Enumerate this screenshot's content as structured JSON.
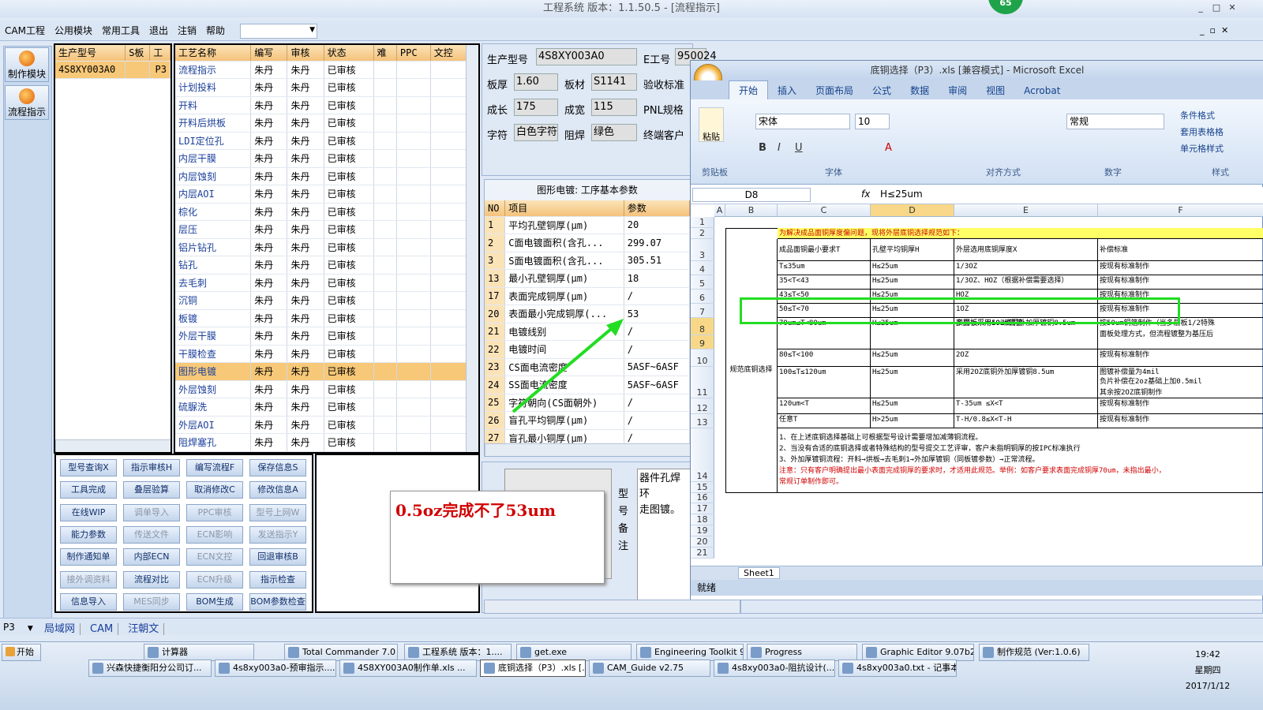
{
  "window": {
    "title": "工程系统   版本：1.1.50.5 - [流程指示]",
    "badge": "65",
    "min": "_",
    "max": "□",
    "close": "✕"
  },
  "menu": {
    "items": [
      "CAM工程",
      "公用模块",
      "常用工具",
      "退出",
      "注销",
      "帮助"
    ],
    "dropdown": ""
  },
  "leftbar": {
    "make_module": "制作模块",
    "flow_indicator": "流程指示"
  },
  "product_list": {
    "headers": [
      "生产型号",
      "S板",
      "工"
    ],
    "row": {
      "model": "4S8XY003A0",
      "code": "P3"
    }
  },
  "process": {
    "headers": [
      "工艺名称",
      "编写",
      "审核",
      "状态",
      "难",
      "PPC",
      "文控"
    ],
    "rows": [
      [
        "流程指示",
        "朱丹",
        "朱丹",
        "已审核"
      ],
      [
        "计划投料",
        "朱丹",
        "朱丹",
        "已审核"
      ],
      [
        "开料",
        "朱丹",
        "朱丹",
        "已审核"
      ],
      [
        "开料后烘板",
        "朱丹",
        "朱丹",
        "已审核"
      ],
      [
        "LDI定位孔",
        "朱丹",
        "朱丹",
        "已审核"
      ],
      [
        "内层干膜",
        "朱丹",
        "朱丹",
        "已审核"
      ],
      [
        "内层蚀刻",
        "朱丹",
        "朱丹",
        "已审核"
      ],
      [
        "内层AOI",
        "朱丹",
        "朱丹",
        "已审核"
      ],
      [
        "棕化",
        "朱丹",
        "朱丹",
        "已审核"
      ],
      [
        "层压",
        "朱丹",
        "朱丹",
        "已审核"
      ],
      [
        "铝片钻孔",
        "朱丹",
        "朱丹",
        "已审核"
      ],
      [
        "钻孔",
        "朱丹",
        "朱丹",
        "已审核"
      ],
      [
        "去毛刺",
        "朱丹",
        "朱丹",
        "已审核"
      ],
      [
        "沉铜",
        "朱丹",
        "朱丹",
        "已审核"
      ],
      [
        "板镀",
        "朱丹",
        "朱丹",
        "已审核"
      ],
      [
        "外层干膜",
        "朱丹",
        "朱丹",
        "已审核"
      ],
      [
        "干膜检查",
        "朱丹",
        "朱丹",
        "已审核"
      ],
      [
        "图形电镀",
        "朱丹",
        "朱丹",
        "已审核"
      ],
      [
        "外层蚀刻",
        "朱丹",
        "朱丹",
        "已审核"
      ],
      [
        "硫脲洗",
        "朱丹",
        "朱丹",
        "已审核"
      ],
      [
        "外层AOI",
        "朱丹",
        "朱丹",
        "已审核"
      ],
      [
        "阻焊塞孔",
        "朱丹",
        "朱丹",
        "已审核"
      ]
    ],
    "selected_index": 17
  },
  "buttons": [
    [
      {
        "l": "型号查询X",
        "d": false
      },
      {
        "l": "指示审核H",
        "d": false
      },
      {
        "l": "编写流程F",
        "d": false
      },
      {
        "l": "保存信息S",
        "d": false
      }
    ],
    [
      {
        "l": "工具完成",
        "d": false
      },
      {
        "l": "叠层验算",
        "d": false
      },
      {
        "l": "取消修改C",
        "d": false
      },
      {
        "l": "修改信息A",
        "d": false
      }
    ],
    [
      {
        "l": "在线WIP",
        "d": false
      },
      {
        "l": "调单导入",
        "d": true
      },
      {
        "l": "PPC审核",
        "d": true
      },
      {
        "l": "型号上网W",
        "d": true
      }
    ],
    [
      {
        "l": "能力参数",
        "d": false
      },
      {
        "l": "传送文件",
        "d": true
      },
      {
        "l": "ECN影响",
        "d": true
      },
      {
        "l": "发送指示Y",
        "d": true
      }
    ],
    [
      {
        "l": "制作通知单",
        "d": false
      },
      {
        "l": "内部ECN",
        "d": false
      },
      {
        "l": "ECN文控",
        "d": true
      },
      {
        "l": "回退审核B",
        "d": false
      }
    ],
    [
      {
        "l": "接外调资料",
        "d": true
      },
      {
        "l": "流程对比",
        "d": false
      },
      {
        "l": "ECN升级",
        "d": true
      },
      {
        "l": "指示检查",
        "d": false
      }
    ],
    [
      {
        "l": "信息导入",
        "d": false
      },
      {
        "l": "MES同步",
        "d": true
      },
      {
        "l": "BOM生成",
        "d": false
      },
      {
        "l": "BOM参数检查",
        "d": false
      }
    ]
  ],
  "info": {
    "model_label": "生产型号",
    "model": "4S8XY003A0",
    "e_label": "E工号",
    "e_value": "950024",
    "thick_label": "板厚",
    "thick": "1.60",
    "material_label": "板材",
    "material": "S1141",
    "accept_label": "验收标准",
    "len_label": "成长",
    "len": "175",
    "wid_label": "成宽",
    "wid": "115",
    "pnl_label": "PNL规格",
    "char_label": "字符",
    "char": "白色字符",
    "mask_label": "阻焊",
    "mask": "绿色",
    "cust_label": "终端客户"
  },
  "plating": {
    "title": "图形电镀: 工序基本参数",
    "headers": [
      "NO",
      "项目",
      "参数"
    ],
    "rows": [
      [
        "1",
        "平均孔壁铜厚(μm)",
        "20"
      ],
      [
        "2",
        "C面电镀面积(含孔...",
        "299.07"
      ],
      [
        "3",
        "S面电镀面积(含孔...",
        "305.51"
      ],
      [
        "13",
        "最小孔壁铜厚(μm)",
        "18"
      ],
      [
        "17",
        "表面完成铜厚(μm)",
        "/"
      ],
      [
        "20",
        "表面最小完成铜厚(...",
        "53"
      ],
      [
        "21",
        "电镀线别",
        "/"
      ],
      [
        "22",
        "电镀时间",
        "/"
      ],
      [
        "23",
        "CS面电流密度",
        "5ASF~6ASF"
      ],
      [
        "24",
        "SS面电流密度",
        "5ASF~6ASF"
      ],
      [
        "25",
        "字符朝向(CS面朝外)",
        "/"
      ],
      [
        "26",
        "盲孔平均铜厚(μm)",
        "/"
      ],
      [
        "27",
        "盲孔最小铜厚(μm)",
        "/"
      ]
    ]
  },
  "remark": {
    "label": "型号备注",
    "text1": "器件孔焊环",
    "text2": "走图镀。"
  },
  "annotation": "0.5oz完成不了53um",
  "excel": {
    "title": "底铜选择（P3）.xls  [兼容模式] - Microsoft Excel",
    "tabs": [
      "开始",
      "插入",
      "页面布局",
      "公式",
      "数据",
      "审阅",
      "视图",
      "Acrobat"
    ],
    "font": "宋体",
    "size": "10",
    "numfmt": "常规",
    "paste": "粘贴",
    "groups": [
      "剪贴板",
      "字体",
      "对齐方式",
      "数字",
      "样式"
    ],
    "styles": [
      "条件格式",
      "套用表格格",
      "单元格样式"
    ],
    "cellref": "D8",
    "fx": "fx",
    "formula": "H≤25um",
    "cols": [
      "A",
      "B",
      "C",
      "D",
      "E",
      "F"
    ],
    "rows": [
      "1",
      "2",
      "3",
      "4",
      "5",
      "6",
      "7",
      "8",
      "9",
      "10",
      "11",
      "12",
      "13",
      "14",
      "15",
      "16",
      "17",
      "18",
      "19",
      "20",
      "21"
    ],
    "banner": "为解决成品面铜厚度偏问题，现将外层底铜选择规范如下：",
    "hdr": [
      "成品面铜最小要求T",
      "孔壁平均铜厚H",
      "外层选用底铜厚度X",
      "补偿标准"
    ],
    "side": "规范底铜选择",
    "data": [
      [
        "T≤35um",
        "H≤25um",
        "1/3OZ",
        "按现有标准制作"
      ],
      [
        "35<T<43",
        "H≤25um",
        "1/3OZ、HOZ（根据补偿需要选择）",
        "按现有标准制作"
      ],
      [
        "43≤T<50",
        "H≤25um",
        "HOZ",
        "按现有标准制作"
      ],
      [
        "50≤T<70",
        "H≤25um",
        "1OZ",
        "按现有标准制作"
      ],
      [
        "70um≤T<80um",
        "H≤25um",
        "多层板采用50um铜箔",
        "按50um铜箔制作（当多层板1/2特殊"
      ],
      [
        "80≤T<100",
        "H≤25um",
        "2OZ",
        "按现有标准制作"
      ],
      [
        "100≤T≤120um",
        "H≤25um",
        "采用2OZ底铜外加厚镀铜8.5um",
        "图镀补偿量为4mil"
      ],
      [
        "120um<T",
        "H≤25um",
        "T-35um ≤X<T",
        "按现有标准制作"
      ],
      [
        "任意T",
        "H>25um",
        "T-H/0.8≤X<T-H",
        "按现有标准制作"
      ]
    ],
    "row8extra": "双面板采用1OZ底铜外加厚镀铜8.5um",
    "row8f2": "面板处理方式，但流程镀整为基压后",
    "row11f2": "负片补偿在2oz基础上加0.5mil",
    "row11f3": "其余按2OZ底铜制作",
    "notes": [
      "1、在上述底铜选择基础上可根据型号设计需要增加减薄铜流程。",
      "2、当没有合适的底铜选择或者特殊结构的型号提交工艺评审，客户未指明铜厚的按IPC标准执行",
      "3、外加厚镀铜流程：开料→烘板→去毛刺1→外加厚镀铜（同板镀参数）→正常流程。",
      "注意：只有客户明确提出最小表面完成铜厚的要求时，才适用此规范。举例：如客户要求表面完成铜厚70um，未指出最小，",
      "常规订单制作即可。"
    ],
    "sheet": "Sheet1",
    "status": "就绪"
  },
  "statusbar": {
    "combo": "P3",
    "tabs": [
      "局域网",
      "CAM",
      "汪朝文"
    ]
  },
  "taskbar": {
    "start": "开始",
    "row1": [
      "计算器",
      "Total Commander 7.0 ...",
      "工程系统  版本：1....",
      "get.exe",
      "Engineering Toolkit 9....",
      "Progress",
      "Graphic Editor 9.07b2 ...",
      "制作规范 (Ver:1.0.6)"
    ],
    "row2": [
      "兴森快捷衡阳分公司订...",
      "4s8xy003a0-预审指示....",
      "4S8XY003A0制作单.xls ...",
      "底铜选择（P3）.xls [...",
      "CAM_Guide v2.75",
      "4s8xy003a0-阻抗设计(...",
      "4s8xy003a0.txt - 记事本"
    ],
    "time": "19:42",
    "weekday": "星期四",
    "date": "2017/1/12"
  },
  "colors": {
    "highlight_row": "#f7c878",
    "annotation_red": "#d00000",
    "arrow_green": "#22dd22",
    "accent": "#1a3f9a"
  }
}
